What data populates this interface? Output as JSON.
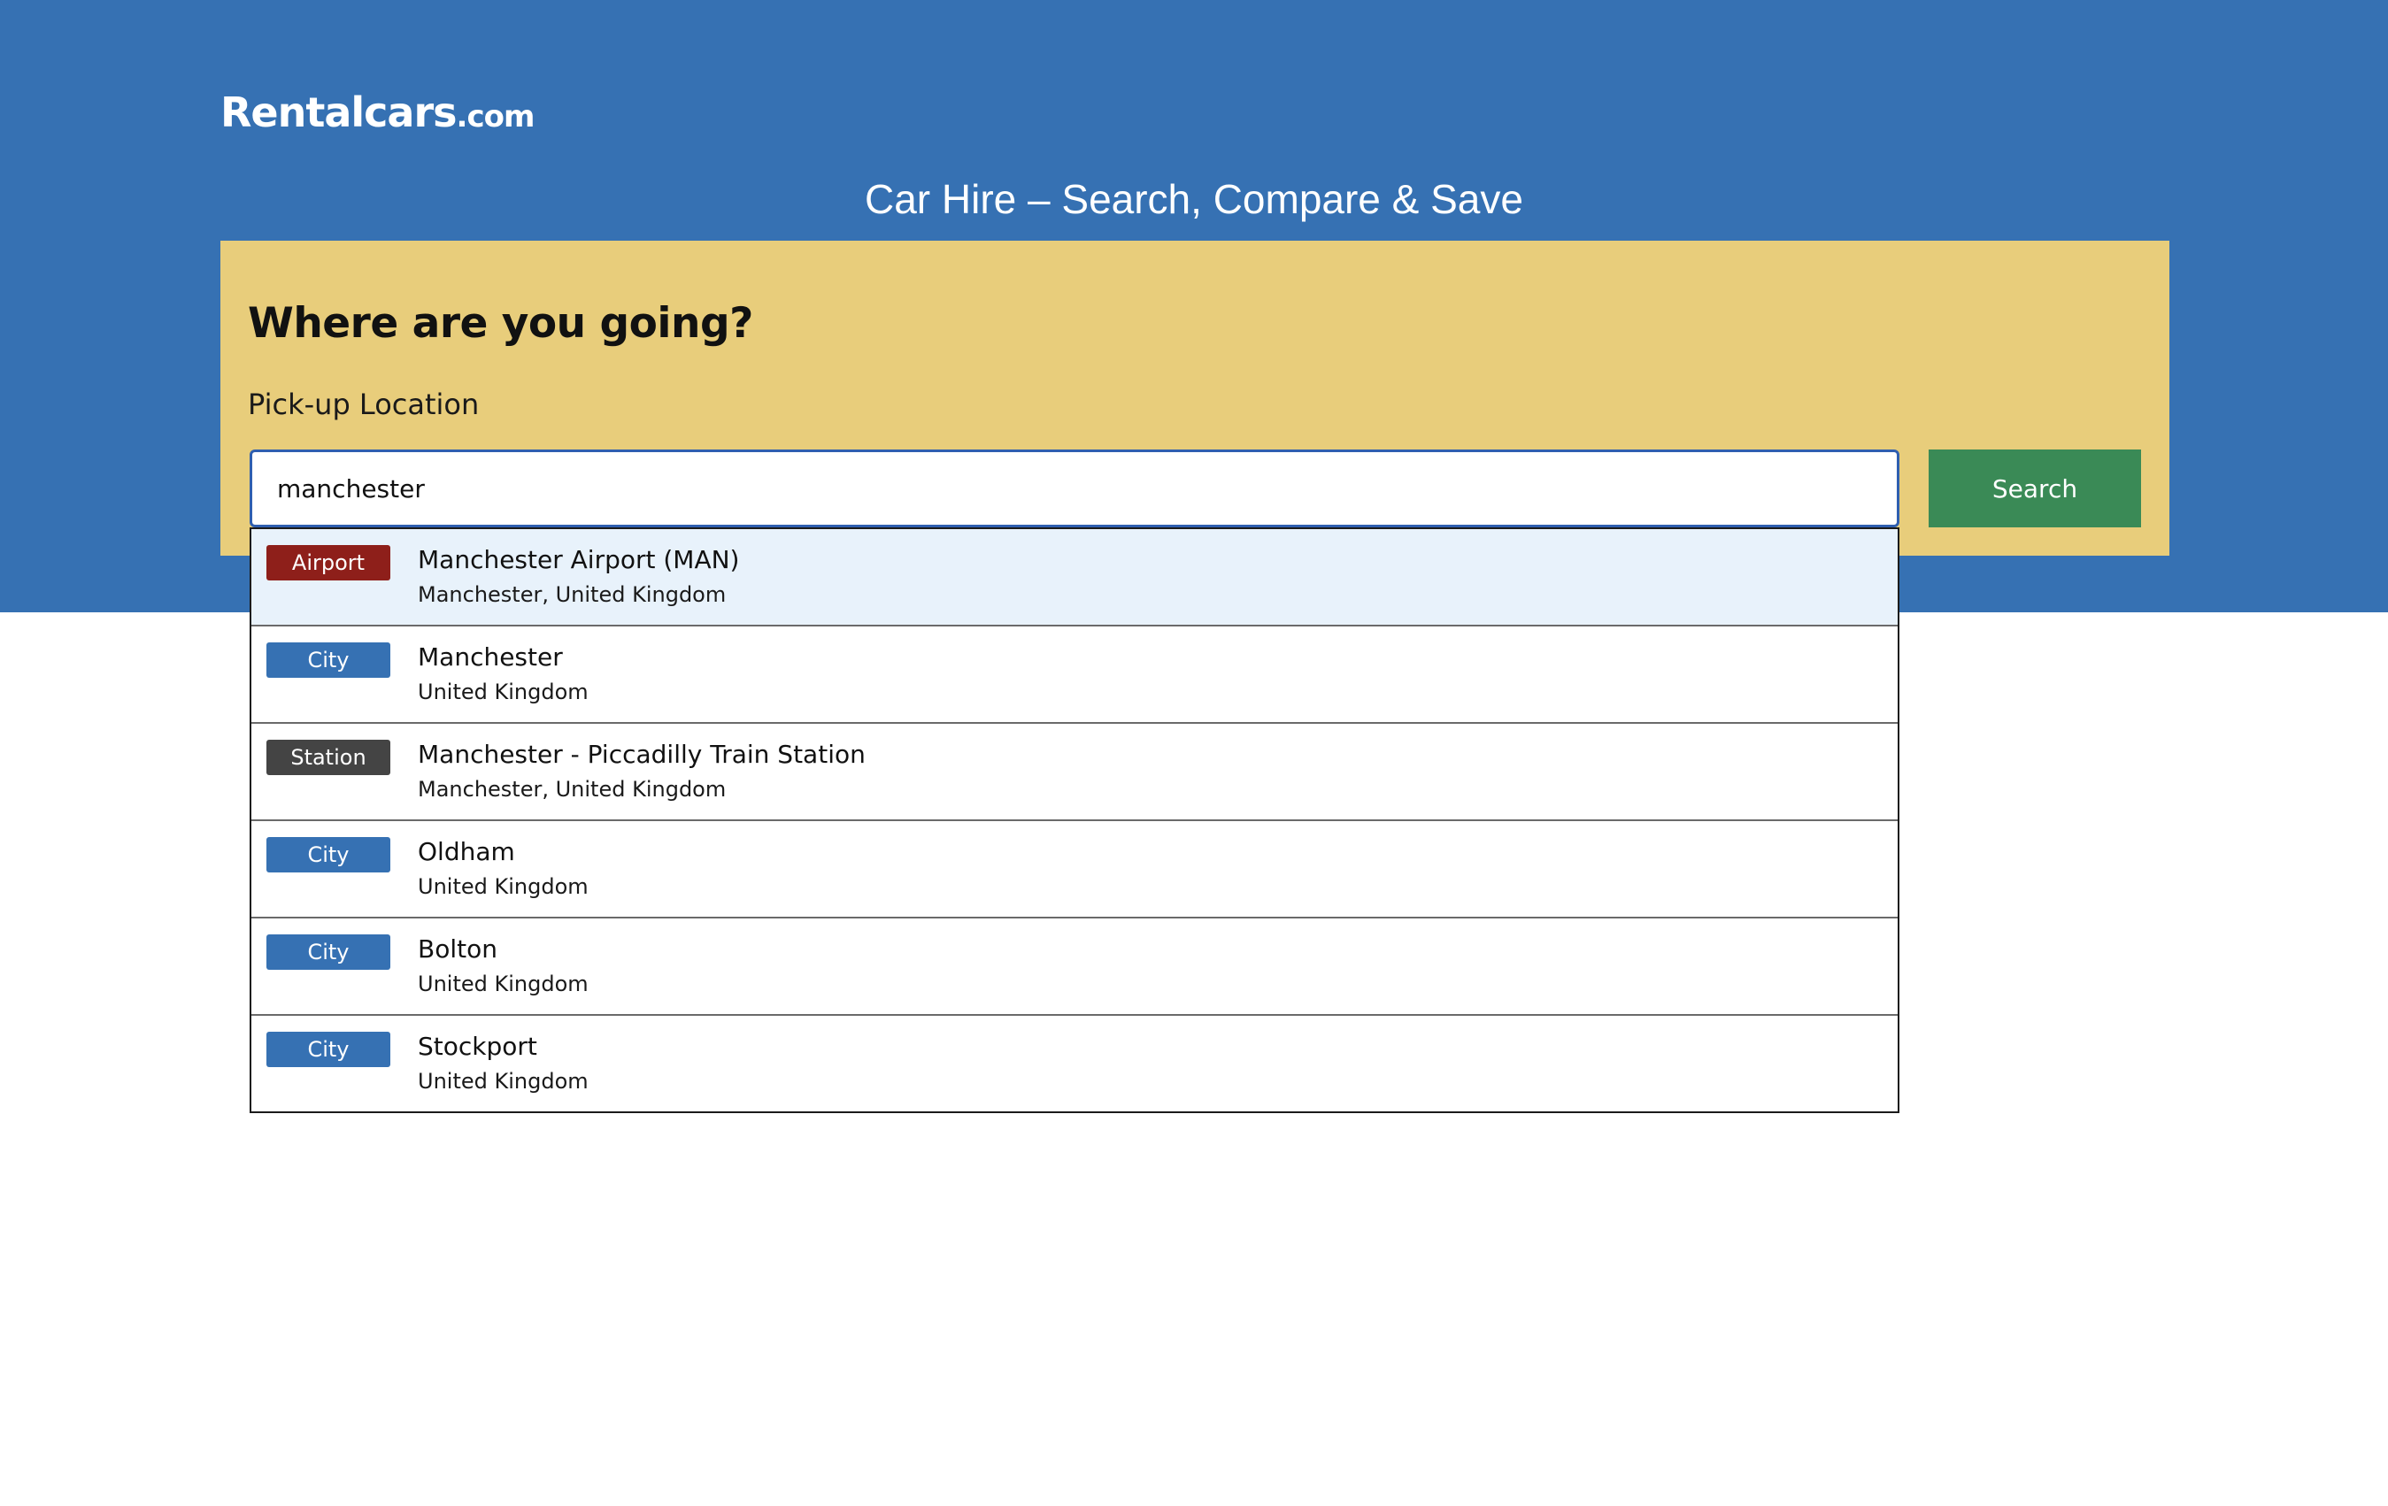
{
  "header": {
    "logo_main": "Rentalcars",
    "logo_tld": ".com",
    "title": "Car Hire – Search, Compare & Save"
  },
  "search": {
    "heading": "Where are you going?",
    "pickup_label": "Pick-up Location",
    "pickup_value": "manchester",
    "button_label": "Search"
  },
  "suggestions": [
    {
      "type": "Airport",
      "name": "Manchester Airport (MAN)",
      "location": "Manchester, United Kingdom"
    },
    {
      "type": "City",
      "name": "Manchester",
      "location": "United Kingdom"
    },
    {
      "type": "Station",
      "name": "Manchester - Piccadilly Train Station",
      "location": "Manchester, United Kingdom"
    },
    {
      "type": "City",
      "name": "Oldham",
      "location": "United Kingdom"
    },
    {
      "type": "City",
      "name": "Bolton",
      "location": "United Kingdom"
    },
    {
      "type": "City",
      "name": "Stockport",
      "location": "United Kingdom"
    }
  ],
  "colors": {
    "brand_blue": "#3671b3",
    "card_yellow": "#e8cd7b",
    "search_green": "#3a8a56",
    "airport_badge": "#8e1f1a",
    "city_badge": "#3671b3",
    "station_badge": "#444444",
    "highlight": "#e8f2fb"
  }
}
